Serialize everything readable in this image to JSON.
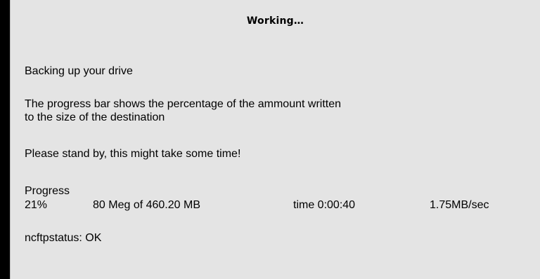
{
  "dialog": {
    "title": "Working…",
    "message": "Backing up your drive",
    "description_line1": "The progress bar shows the percentage of the ammount written",
    "description_line2": "to the size of the destination",
    "standby": "Please stand by, this might take some time!",
    "progress_label": "Progress",
    "progress": {
      "percent": "21%",
      "amount": "80 Meg of 460.20 MB",
      "time": "time 0:00:40",
      "rate": "1.75MB/sec"
    },
    "status": "ncftpstatus: OK"
  },
  "colors": {
    "background": "#000000",
    "dialog": "#e4e4e4",
    "text": "#000000"
  }
}
